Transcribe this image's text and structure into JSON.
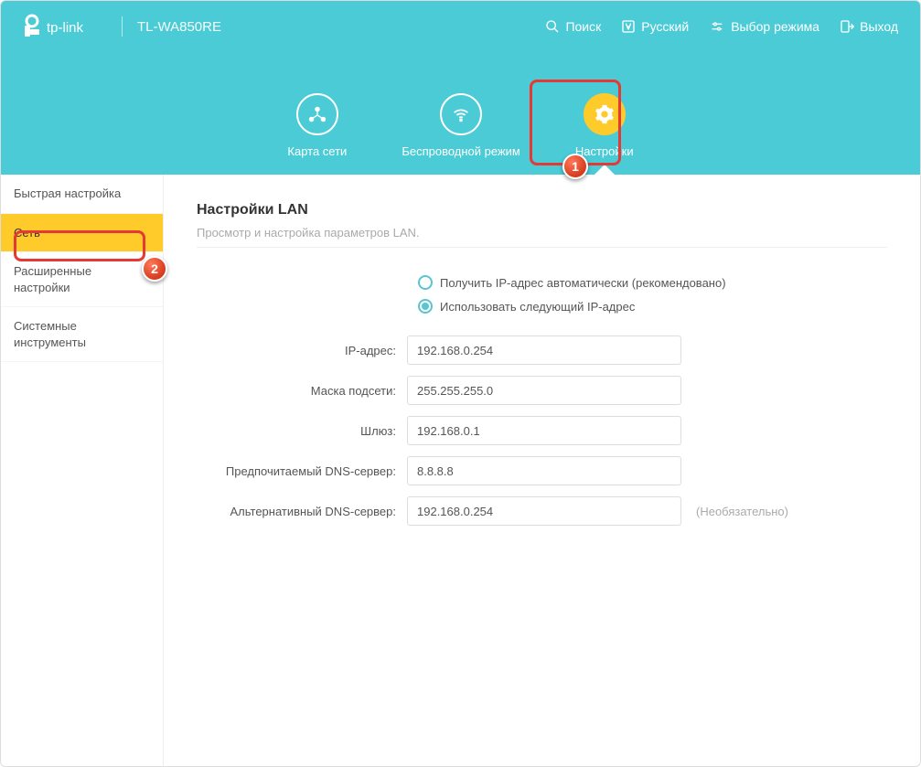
{
  "brand": {
    "model": "TL-WA850RE"
  },
  "top": {
    "search": "Поиск",
    "language": "Русский",
    "mode": "Выбор режима",
    "logout": "Выход"
  },
  "nav": {
    "map": "Карта сети",
    "wireless": "Беспроводной режим",
    "settings": "Настройки"
  },
  "sidebar": {
    "items": [
      {
        "label": "Быстрая настройка"
      },
      {
        "label": "Сеть"
      },
      {
        "label": "Расширенные настройки"
      },
      {
        "label": "Системные инструменты"
      }
    ]
  },
  "page": {
    "title": "Настройки LAN",
    "subtitle": "Просмотр и настройка параметров LAN."
  },
  "radio": {
    "auto": "Получить IP-адрес автоматически (рекомендовано)",
    "manual": "Использовать следующий IP-адрес"
  },
  "form": {
    "ip_label": "IP-адрес:",
    "ip_value": "192.168.0.254",
    "mask_label": "Маска подсети:",
    "mask_value": "255.255.255.0",
    "gateway_label": "Шлюз:",
    "gateway_value": "192.168.0.1",
    "dns1_label": "Предпочитаемый DNS-cервер:",
    "dns1_value": "8.8.8.8",
    "dns2_label": "Альтернативный DNS-cервер:",
    "dns2_value": "192.168.0.254",
    "optional": "(Необязательно)"
  },
  "annotations": {
    "badge1": "1",
    "badge2": "2"
  }
}
